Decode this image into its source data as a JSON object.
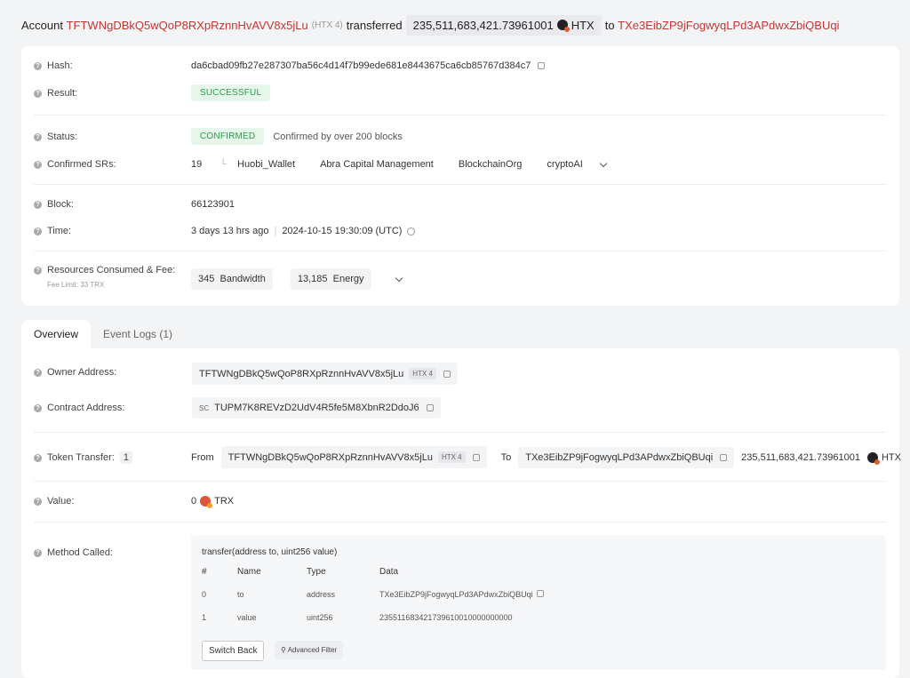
{
  "header": {
    "prefix": "Account",
    "from_addr": "TFTWNgDBkQ5wQoP8RXpRznnHvAVV8x5jLu",
    "from_tag": "(HTX 4)",
    "verb": "transferred",
    "amount": "235,511,683,421.73961001",
    "token": "HTX",
    "to_word": "to",
    "to_addr": "TXe3EibZP9jFogwyqLPd3APdwxZbiQBUqi"
  },
  "summary": {
    "hash_label": "Hash:",
    "hash_value": "da6cbad09fb27e287307ba56c4d14f7b99ede681e8443675ca6cb85767d384c7",
    "result_label": "Result:",
    "result_value": "SUCCESSFUL",
    "status_label": "Status:",
    "status_value": "CONFIRMED",
    "status_note": "Confirmed by over 200 blocks",
    "srs_label": "Confirmed SRs:",
    "srs_count": "19",
    "srs": [
      "Huobi_Wallet",
      "Abra Capital Management",
      "BlockchainOrg",
      "cryptoAI"
    ],
    "block_label": "Block:",
    "block_value": "66123901",
    "time_label": "Time:",
    "time_ago": "3 days 13 hrs ago",
    "time_sep": "|",
    "time_value": "2024-10-15 19:30:09 (UTC)",
    "res_label": "Resources Consumed & Fee:",
    "fee_limit": "Fee Limit: 33 TRX",
    "bandwidth_num": "345",
    "bandwidth_label": "Bandwidth",
    "energy_num": "13,185",
    "energy_label": "Energy"
  },
  "tabs": [
    "Overview",
    "Event Logs (1)"
  ],
  "overview": {
    "owner_label": "Owner Address:",
    "owner_value": "TFTWNgDBkQ5wQoP8RXpRznnHvAVV8x5jLu",
    "owner_tag": "HTX 4",
    "contract_label": "Contract Address:",
    "contract_prefix": "SC",
    "contract_value": "TUPM7K8REVzD2UdV4R5fe5M8XbnR2DdoJ6",
    "transfer_label": "Token Transfer:",
    "transfer_count": "1",
    "from_word": "From",
    "from_addr": "TFTWNgDBkQ5wQoP8RXpRznnHvAVV8x5jLu",
    "from_tag": "HTX 4",
    "to_word": "To",
    "to_addr": "TXe3EibZP9jFogwyqLPd3APdwxZbiQBUqi",
    "amount": "235,511,683,421.73961001",
    "token": "HTX",
    "value_label": "Value:",
    "value_num": "0",
    "value_token": "TRX",
    "method_label": "Method Called:"
  },
  "method": {
    "signature": "transfer(address to, uint256 value)",
    "headers": [
      "#",
      "Name",
      "Type",
      "Data"
    ],
    "rows": [
      {
        "idx": "0",
        "name": "to",
        "type": "address",
        "data": "TXe3EibZP9jFogwyqLPd3APdwxZbiQBUqi"
      },
      {
        "idx": "1",
        "name": "value",
        "type": "uint256",
        "data": "235511683421739610010000000000"
      }
    ],
    "switch_back": "Switch Back",
    "advanced_filter": "Advanced Filter"
  },
  "colors": {
    "red": "#c23631",
    "green": "#2a9d4a",
    "bg": "#f3f4f6"
  }
}
